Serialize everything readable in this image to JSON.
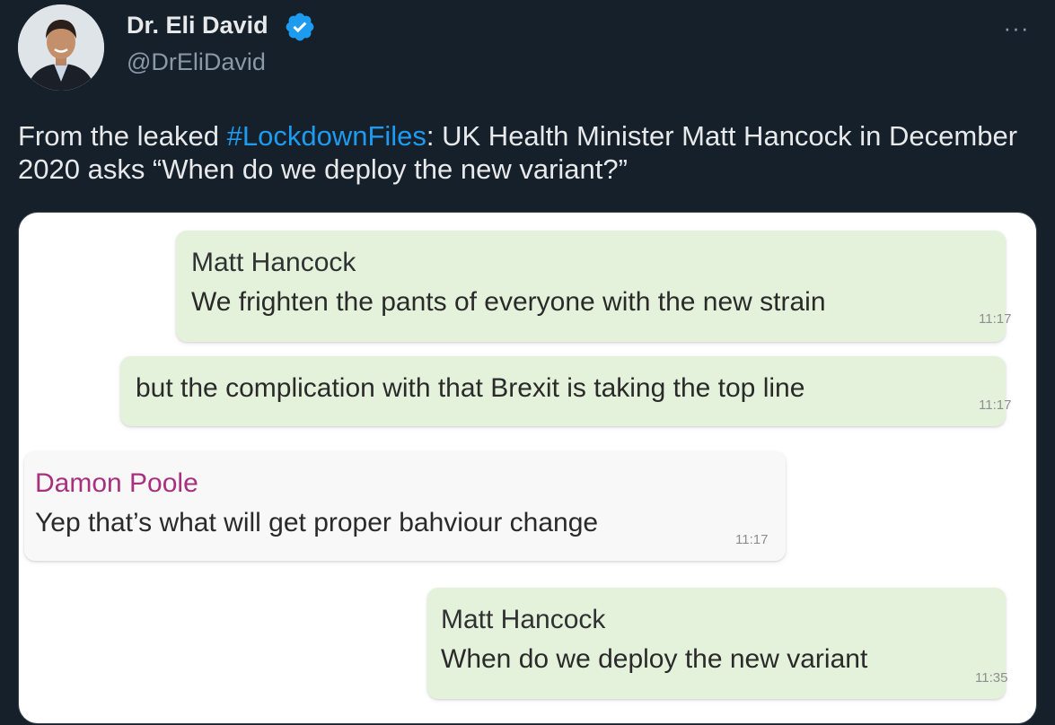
{
  "author": {
    "name": "Dr. Eli David",
    "handle": "@DrEliDavid"
  },
  "more_menu": {
    "label": "···"
  },
  "tweet": {
    "text_before": "From the leaked ",
    "hashtag": "#LockdownFiles",
    "text_after": ": UK Health Minister Matt Hancock in December 2020 asks “When do we deploy the new variant?”"
  },
  "chat": {
    "messages": [
      {
        "sender": "Matt Hancock",
        "text": "We frighten the pants of everyone with the new strain",
        "time": "11:17"
      },
      {
        "sender": "",
        "text": "but the complication with that Brexit is taking the top line",
        "time": "11:17"
      },
      {
        "sender": "Damon Poole",
        "text": "Yep that’s what will get proper bahviour change",
        "time": "11:17"
      },
      {
        "sender": "Matt Hancock",
        "text": "When do we deploy the new variant",
        "time": "11:35"
      }
    ]
  },
  "colors": {
    "background": "#15202b",
    "accent": "#1d9bf0",
    "outgoing_bubble": "#e4f2db",
    "incoming_bubble": "#f8f8f8",
    "sender_pink": "#a8307f"
  },
  "icons": {
    "verified": "verified-badge-icon",
    "more": "more-options-icon"
  }
}
